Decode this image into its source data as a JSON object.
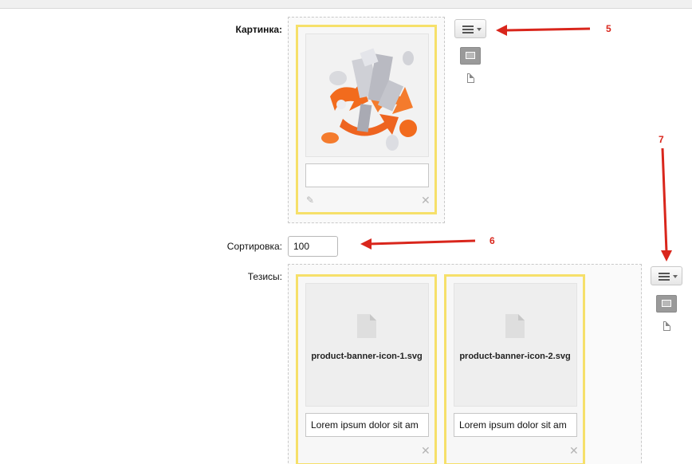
{
  "form": {
    "picture_label": "Картинка:",
    "sort_label": "Сортировка:",
    "sort_value": "100",
    "theses_label": "Тезисы:"
  },
  "picture": {
    "description_value": "",
    "icons": [
      "pencil-icon",
      "close-icon"
    ]
  },
  "toolbar": {
    "menu_icon": "menu-lines-icon",
    "image_icon": "image-icon",
    "file_icon": "file-icon"
  },
  "theses": {
    "items": [
      {
        "file_name": "product-banner-icon-1.svg",
        "description_value": "Lorem ipsum dolor sit am"
      },
      {
        "file_name": "product-banner-icon-2.svg",
        "description_value": "Lorem ipsum dolor sit am"
      }
    ]
  },
  "annotations": {
    "five": "5",
    "six": "6",
    "seven": "7",
    "arrow_color": "#d9261c"
  },
  "colors": {
    "card_border": "#f6e06a",
    "accent_orange": "#f26b1d"
  }
}
